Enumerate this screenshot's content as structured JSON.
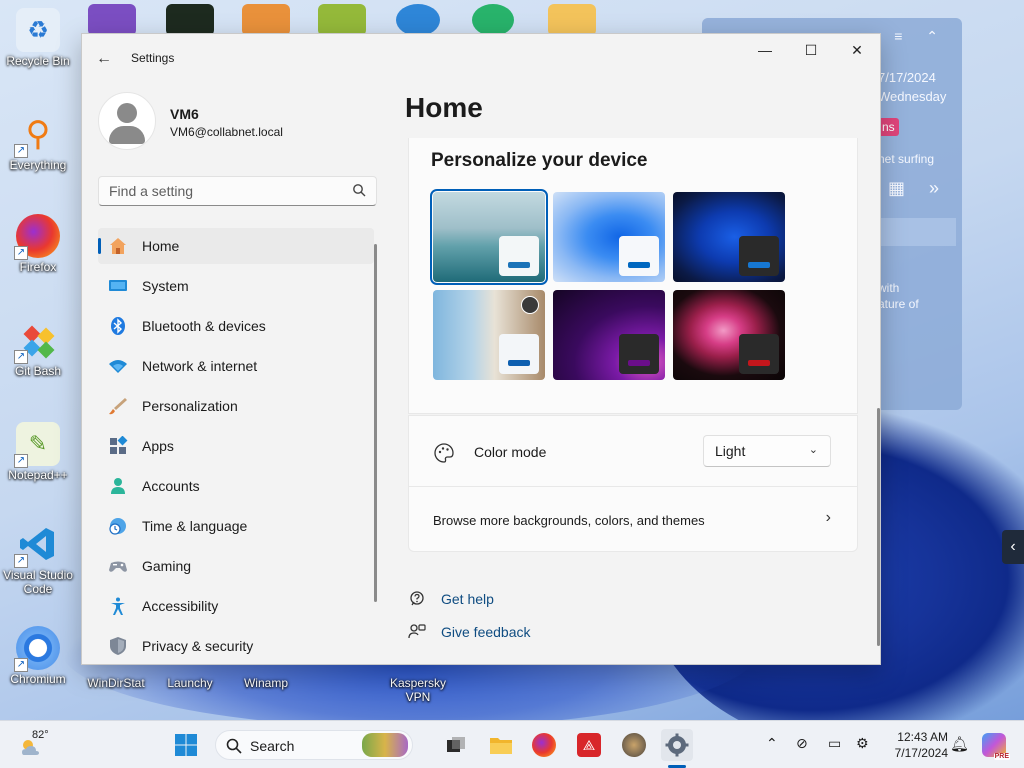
{
  "window": {
    "app_title": "Settings",
    "back": "←",
    "minimize": "—",
    "maximize": "☐",
    "close": "✕"
  },
  "profile": {
    "name": "VM6",
    "email": "VM6@collabnet.local"
  },
  "search": {
    "placeholder": "Find a setting"
  },
  "nav": {
    "items": [
      {
        "label": "Home",
        "icon": "home-icon",
        "active": true
      },
      {
        "label": "System",
        "icon": "system-icon"
      },
      {
        "label": "Bluetooth & devices",
        "icon": "bluetooth-icon"
      },
      {
        "label": "Network & internet",
        "icon": "wifi-icon"
      },
      {
        "label": "Personalization",
        "icon": "brush-icon"
      },
      {
        "label": "Apps",
        "icon": "apps-icon"
      },
      {
        "label": "Accounts",
        "icon": "accounts-icon"
      },
      {
        "label": "Time & language",
        "icon": "clock-globe-icon"
      },
      {
        "label": "Gaming",
        "icon": "gamepad-icon"
      },
      {
        "label": "Accessibility",
        "icon": "accessibility-icon"
      },
      {
        "label": "Privacy & security",
        "icon": "shield-icon"
      }
    ]
  },
  "main": {
    "title": "Home",
    "personalize": {
      "title": "Personalize your device",
      "accent_colors": [
        "#1a73b8",
        "#0067c0",
        "#1677d2",
        "#0d5fb0",
        "#6a0e8a",
        "#c4161c"
      ]
    },
    "color_mode": {
      "label": "Color mode",
      "value": "Light",
      "caret": "⌄"
    },
    "browse": {
      "label": "Browse more backgrounds, colors, and themes",
      "chevron": "›"
    },
    "links": {
      "get_help": "Get help",
      "give_feedback": "Give feedback"
    }
  },
  "desktop": {
    "icons": [
      {
        "label": "Recycle Bin",
        "icon": "recycle-bin-icon"
      },
      {
        "label": "Everything",
        "icon": "everything-icon"
      },
      {
        "label": "Firefox",
        "icon": "firefox-icon"
      },
      {
        "label": "Git Bash",
        "icon": "git-bash-icon"
      },
      {
        "label": "Notepad++",
        "icon": "notepadpp-icon"
      },
      {
        "label": "Visual Studio Code",
        "icon": "vscode-icon"
      },
      {
        "label": "Chromium",
        "icon": "chromium-icon"
      }
    ],
    "bottom_labels": [
      "WinDirStat",
      "Launchy",
      "Winamp",
      "Kaspersky VPN"
    ],
    "side_chevron": "‹"
  },
  "widget": {
    "date": "7/17/2024",
    "day": "Wednesday",
    "badge": "ns",
    "line1": "net surfing",
    "line2a": "with",
    "line2b": "ature of"
  },
  "taskbar": {
    "temperature": "82°",
    "search_label": "Search",
    "time": "12:43 AM",
    "date": "7/17/2024",
    "copilot_badge": "PRE"
  }
}
